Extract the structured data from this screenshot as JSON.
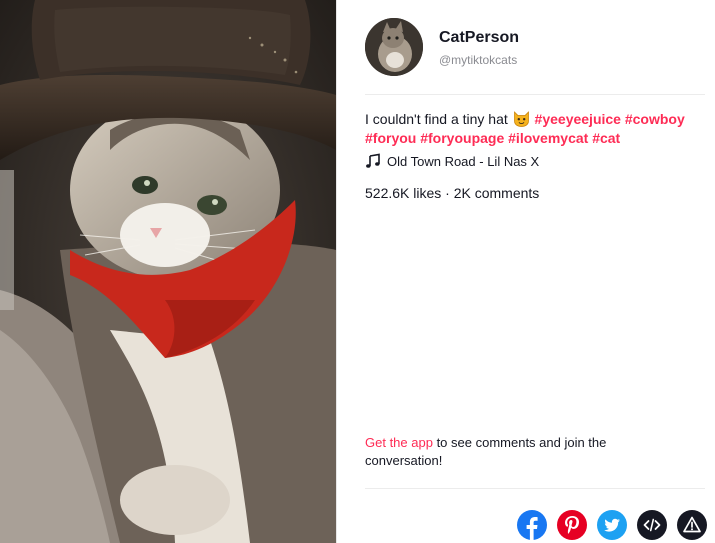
{
  "author": {
    "display_name": "CatPerson",
    "handle": "@mytiktokcats"
  },
  "caption": {
    "text": "I couldn't find a tiny hat",
    "emoji": "cat-face-emoji",
    "hashtags": [
      "#yeeyeejuice",
      "#cowboy",
      "#foryou",
      "#foryoupage",
      "#ilovemycat",
      "#cat"
    ]
  },
  "music": {
    "icon": "music-note-icon",
    "title": "Old Town Road - Lil Nas X"
  },
  "stats": {
    "text": "522.6K likes · 2K comments"
  },
  "cta": {
    "link_label": "Get the app",
    "rest": " to see comments and join the conversation!"
  },
  "share": [
    {
      "name": "facebook",
      "icon": "facebook-icon",
      "color": "#1877f2"
    },
    {
      "name": "pinterest",
      "icon": "pinterest-icon",
      "color": "#e60023"
    },
    {
      "name": "twitter",
      "icon": "twitter-icon",
      "color": "#1da1f2"
    },
    {
      "name": "embed",
      "icon": "embed-code-icon",
      "color": "#161823"
    },
    {
      "name": "report",
      "icon": "warning-icon",
      "color": "#161823"
    }
  ],
  "colors": {
    "accent": "#fe2c55",
    "text": "#161823",
    "muted": "#8a8b91"
  }
}
